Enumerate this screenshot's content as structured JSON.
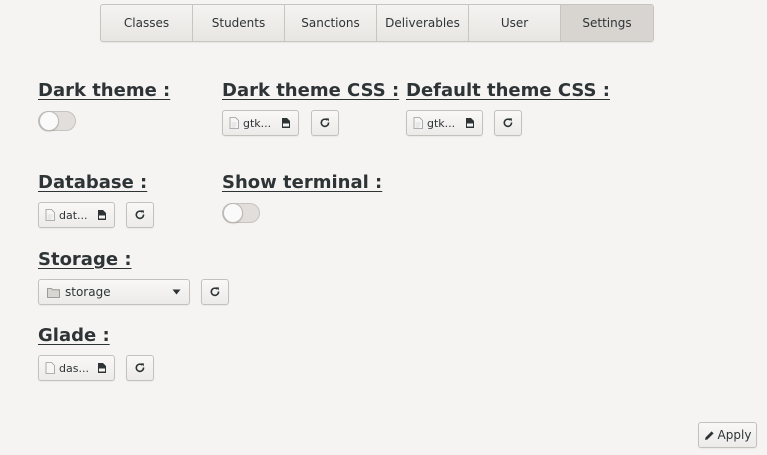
{
  "tabs": [
    {
      "label": "Classes",
      "active": false
    },
    {
      "label": "Students",
      "active": false
    },
    {
      "label": "Sanctions",
      "active": false
    },
    {
      "label": "Deliverables",
      "active": false
    },
    {
      "label": "User",
      "active": false
    },
    {
      "label": "Settings",
      "active": true
    }
  ],
  "settings": {
    "dark_theme": {
      "label": "Dark theme :",
      "enabled": false
    },
    "dark_theme_css": {
      "label": "Dark theme CSS :",
      "file": "gtk..."
    },
    "default_theme_css": {
      "label": "Default theme CSS :",
      "file": "gtk..."
    },
    "database": {
      "label": "Database :",
      "file": "dat..."
    },
    "show_terminal": {
      "label": "Show terminal :",
      "enabled": false
    },
    "storage": {
      "label": "Storage :",
      "value": "storage"
    },
    "glade": {
      "label": "Glade :",
      "file": "das..."
    }
  },
  "apply_label": "Apply",
  "icons": {
    "file": "document-icon",
    "open": "open-file-icon",
    "reload": "reload-icon",
    "folder": "folder-icon",
    "dropdown": "dropdown-arrow-icon",
    "apply": "pencil-icon"
  }
}
